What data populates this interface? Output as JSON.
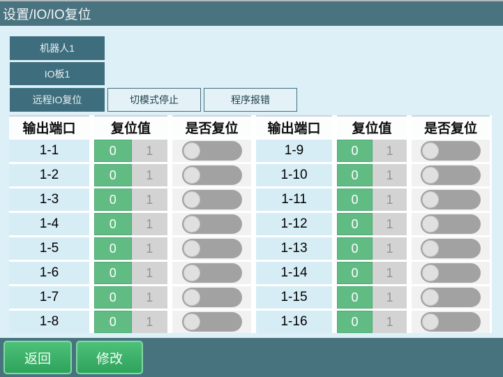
{
  "title_bar": {
    "title": "设置/IO/IO复位"
  },
  "nav": {
    "robot_button": "机器人1",
    "io_board_button": "IO板1",
    "tabs": [
      {
        "label": "远程IO复位",
        "active": true
      },
      {
        "label": "切模式停止",
        "active": false
      },
      {
        "label": "程序报错",
        "active": false
      }
    ]
  },
  "table": {
    "headers": [
      "输出端口",
      "复位值",
      "是否复位"
    ],
    "header_groups": 2,
    "rows": [
      {
        "port": "1-1",
        "options": [
          "0",
          "1"
        ],
        "reset_value": "0",
        "reset_enabled": "off"
      },
      {
        "port": "1-2",
        "options": [
          "0",
          "1"
        ],
        "reset_value": "0",
        "reset_enabled": "off"
      },
      {
        "port": "1-3",
        "options": [
          "0",
          "1"
        ],
        "reset_value": "0",
        "reset_enabled": "off"
      },
      {
        "port": "1-4",
        "options": [
          "0",
          "1"
        ],
        "reset_value": "0",
        "reset_enabled": "off"
      },
      {
        "port": "1-5",
        "options": [
          "0",
          "1"
        ],
        "reset_value": "0",
        "reset_enabled": "off"
      },
      {
        "port": "1-6",
        "options": [
          "0",
          "1"
        ],
        "reset_value": "0",
        "reset_enabled": "off"
      },
      {
        "port": "1-7",
        "options": [
          "0",
          "1"
        ],
        "reset_value": "0",
        "reset_enabled": "off"
      },
      {
        "port": "1-8",
        "options": [
          "0",
          "1"
        ],
        "reset_value": "0",
        "reset_enabled": "off"
      },
      {
        "port": "1-9",
        "options": [
          "0",
          "1"
        ],
        "reset_value": "0",
        "reset_enabled": "off"
      },
      {
        "port": "1-10",
        "options": [
          "0",
          "1"
        ],
        "reset_value": "0",
        "reset_enabled": "off"
      },
      {
        "port": "1-11",
        "options": [
          "0",
          "1"
        ],
        "reset_value": "0",
        "reset_enabled": "off"
      },
      {
        "port": "1-12",
        "options": [
          "0",
          "1"
        ],
        "reset_value": "0",
        "reset_enabled": "off"
      },
      {
        "port": "1-13",
        "options": [
          "0",
          "1"
        ],
        "reset_value": "0",
        "reset_enabled": "off"
      },
      {
        "port": "1-14",
        "options": [
          "0",
          "1"
        ],
        "reset_value": "0",
        "reset_enabled": "off"
      },
      {
        "port": "1-15",
        "options": [
          "0",
          "1"
        ],
        "reset_value": "0",
        "reset_enabled": "off"
      },
      {
        "port": "1-16",
        "options": [
          "0",
          "1"
        ],
        "reset_value": "0",
        "reset_enabled": "off"
      }
    ]
  },
  "footer": {
    "back_button": "返回",
    "modify_button": "修改"
  },
  "colors": {
    "titlebar_teal": "#4a7380",
    "nav_button_teal": "#3e6e7d",
    "page_bg": "#ddeff7",
    "row_bg": "#d7edf6",
    "selected_green": "#60bc83",
    "selected_green_border": "#4aa871",
    "unselected_gray": "#d3d3d3",
    "toggle_track_gray": "#a2a2a2",
    "toggle_knob_gray": "#e0e0e0",
    "footer_button_green": "#3cb169",
    "footer_bar_teal": "#47737f"
  }
}
